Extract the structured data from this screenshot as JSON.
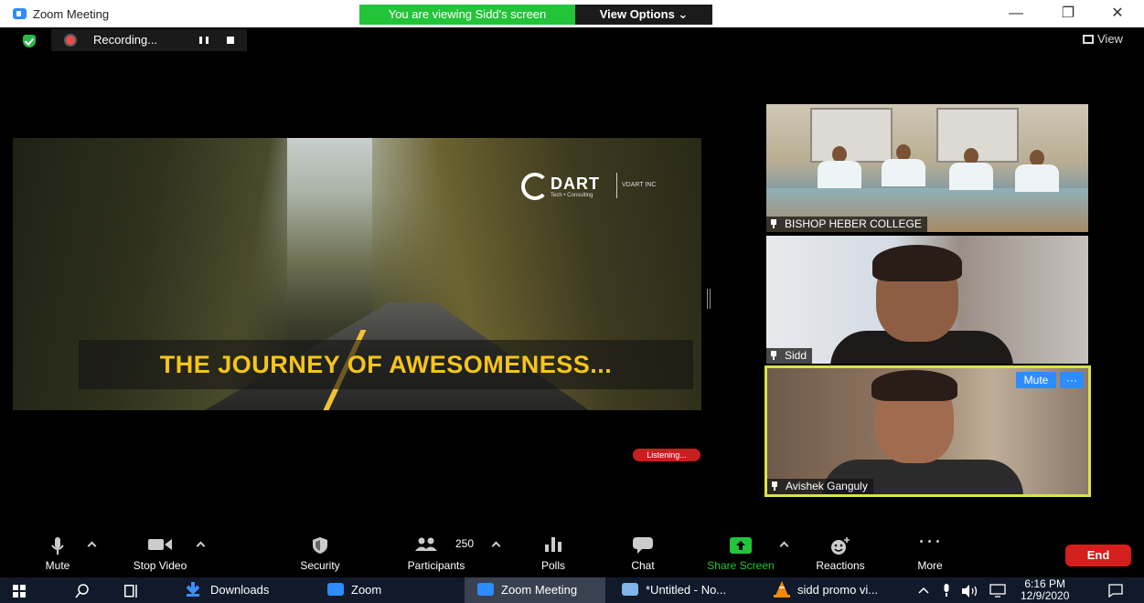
{
  "window": {
    "title": "Zoom Meeting",
    "banner": "You are viewing Sidd's screen",
    "view_options": "View Options ⌄",
    "minimize": "—",
    "maximize": "❐",
    "close": "✕"
  },
  "meeting_bar": {
    "recording": "Recording...",
    "view": "View"
  },
  "shared_screen": {
    "logo_text": "DART",
    "logo_sub": "Tech • Consulting",
    "logo_inc": "VDART INC",
    "caption": "THE JOURNEY OF AWESOMENESS...",
    "listening": "Listening..."
  },
  "participants": [
    {
      "name": "BISHOP HEBER COLLEGE"
    },
    {
      "name": "Sidd"
    },
    {
      "name": "Avishek Ganguly"
    }
  ],
  "tile_controls": {
    "mute": "Mute",
    "more": "···"
  },
  "toolbar": {
    "mute": "Mute",
    "stop_video": "Stop Video",
    "security": "Security",
    "participants": "Participants",
    "participants_count": "250",
    "polls": "Polls",
    "chat": "Chat",
    "share_screen": "Share Screen",
    "reactions": "Reactions",
    "more": "More",
    "more_dots": "• • •",
    "end": "End"
  },
  "taskbar": {
    "downloads": "Downloads",
    "zoom": "Zoom",
    "zoom_meeting": "Zoom Meeting",
    "notepad": "*Untitled - No...",
    "vlc": "sidd promo vi...",
    "time": "6:16 PM",
    "date": "12/9/2020"
  },
  "colors": {
    "zoom_blue": "#2d8cff",
    "banner_green": "#23c438",
    "end_red": "#d51e1e",
    "share_green": "#23c438",
    "active_speaker": "#d8e44a",
    "caption_yellow": "#f5c518"
  }
}
